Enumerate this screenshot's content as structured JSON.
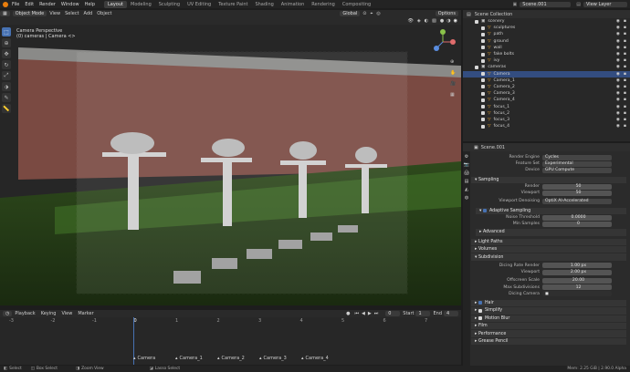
{
  "menu": {
    "items": [
      "File",
      "Edit",
      "Render",
      "Window",
      "Help"
    ]
  },
  "workspaces": [
    "Layout",
    "Modeling",
    "Sculpting",
    "UV Editing",
    "Texture Paint",
    "Shading",
    "Animation",
    "Rendering",
    "Compositing"
  ],
  "active_workspace": "Layout",
  "scene": {
    "name": "Scene.001"
  },
  "view_layer": "View Layer",
  "viewport_header": {
    "mode": "Object Mode",
    "view": "View",
    "select": "Select",
    "add": "Add",
    "object": "Object",
    "orientation": "Global",
    "options": "Options"
  },
  "viewport": {
    "title": "Camera Perspective",
    "subtitle": "(0) cameras | Camera <>"
  },
  "outliner": {
    "title": "Scene Collection",
    "rows": [
      {
        "name": "scenery",
        "indent": 1,
        "selected": false
      },
      {
        "name": "sculptures",
        "indent": 2,
        "selected": false
      },
      {
        "name": "path",
        "indent": 2,
        "selected": false
      },
      {
        "name": "ground",
        "indent": 2,
        "selected": false
      },
      {
        "name": "wall",
        "indent": 2,
        "selected": false
      },
      {
        "name": "fake bolts",
        "indent": 2,
        "selected": false
      },
      {
        "name": "ivy",
        "indent": 2,
        "selected": false
      },
      {
        "name": "cameras",
        "indent": 1,
        "selected": false
      },
      {
        "name": "Camera",
        "indent": 2,
        "selected": true
      },
      {
        "name": "Camera_1",
        "indent": 2,
        "selected": false
      },
      {
        "name": "Camera_2",
        "indent": 2,
        "selected": false
      },
      {
        "name": "Camera_3",
        "indent": 2,
        "selected": false
      },
      {
        "name": "Camera_4",
        "indent": 2,
        "selected": false
      },
      {
        "name": "focus_1",
        "indent": 2,
        "selected": false
      },
      {
        "name": "focus_2",
        "indent": 2,
        "selected": false
      },
      {
        "name": "focus_3",
        "indent": 2,
        "selected": false
      },
      {
        "name": "focus_4",
        "indent": 2,
        "selected": false
      }
    ]
  },
  "properties": {
    "scene_field": "Scene.001",
    "render_engine_label": "Render Engine",
    "render_engine": "Cycles",
    "feature_set_label": "Feature Set",
    "feature_set": "Experimental",
    "device_label": "Device",
    "device": "GPU Compute",
    "sampling": "Sampling",
    "render_label": "Render",
    "render": "50",
    "viewport_label": "Viewport",
    "viewport": "50",
    "denoising_label": "Viewport Denoising",
    "denoising": "OptiX AI-Accelerated",
    "adaptive": "Adaptive Sampling",
    "noise_label": "Noise Threshold",
    "noise": "0.0000",
    "minsamples_label": "Min Samples",
    "minsamples": "0",
    "advanced": "Advanced",
    "light_paths": "Light Paths",
    "volumes": "Volumes",
    "subdivision": "Subdivision",
    "dicing_render_label": "Dicing Rate Render",
    "dicing_render": "1.00 px",
    "sub_viewport_label": "Viewport",
    "sub_viewport": "2.00 px",
    "offscreen_label": "Offscreen Scale",
    "offscreen": "20.00",
    "maxsub_label": "Max Subdivisions",
    "maxsub": "12",
    "dicing_camera_label": "Dicing Camera",
    "hair": "Hair",
    "simplify": "Simplify",
    "motion_blur": "Motion Blur",
    "film": "Film",
    "performance": "Performance",
    "grease_pencil": "Grease Pencil"
  },
  "timeline": {
    "playback": "Playback",
    "keying": "Keying",
    "view": "View",
    "marker": "Marker",
    "current_frame": "0",
    "start_label": "Start",
    "start": "1",
    "end_label": "End",
    "end": "4",
    "ticks": [
      "-3",
      "-2",
      "-1",
      "0",
      "1",
      "2",
      "3",
      "4",
      "5",
      "6",
      "7"
    ],
    "markers": [
      "Camera",
      "Camera_1",
      "Camera_2",
      "Camera_3",
      "Camera_4"
    ]
  },
  "status": {
    "select": "Select",
    "box_select": "Box Select",
    "zoom_view": "Zoom View",
    "lasso_select": "Lasso Select",
    "stats": "Mem: 2.25 GiB | 2.90.0 Alpha"
  }
}
